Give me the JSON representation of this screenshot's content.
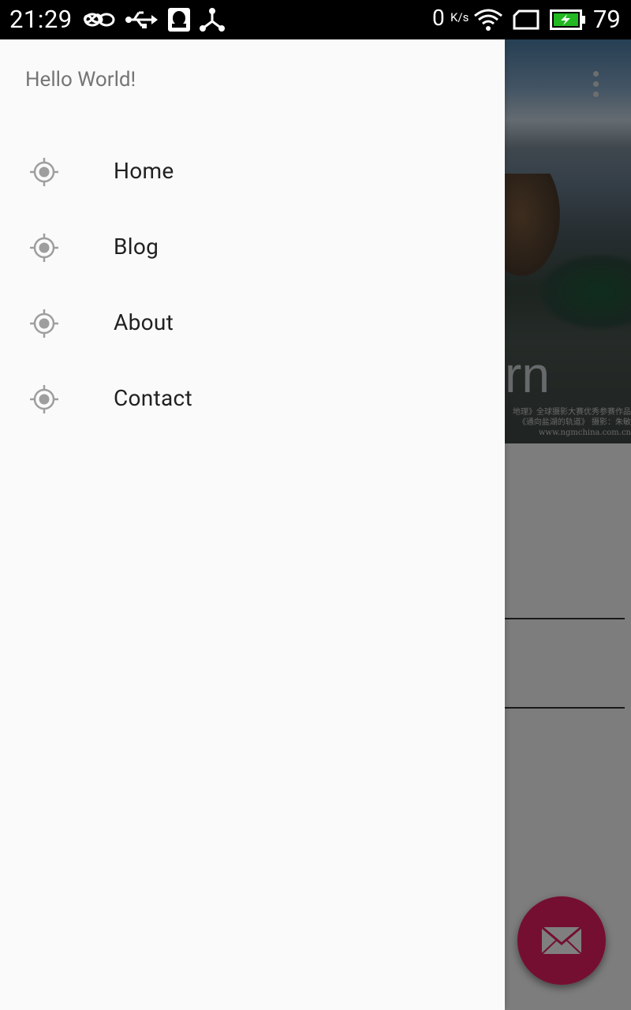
{
  "status_bar": {
    "time": "21:29",
    "net_speed": "0",
    "net_unit": "K/s",
    "battery_level": "79",
    "icons": [
      "infinity-icon",
      "usb-icon",
      "qq-icon",
      "share-icon",
      "wifi-icon",
      "sim-icon",
      "battery-charging-icon"
    ]
  },
  "drawer": {
    "header": "Hello World!",
    "items": [
      {
        "label": "Home",
        "icon": "target-icon"
      },
      {
        "label": "Blog",
        "icon": "target-icon"
      },
      {
        "label": "About",
        "icon": "target-icon"
      },
      {
        "label": "Contact",
        "icon": "target-icon"
      }
    ]
  },
  "background": {
    "image_caption_big": "rn",
    "image_caption_line1": "地理》全球摄影大赛优秀参赛作品",
    "image_caption_line2": "《通向盐湖的轨道》 摄影：朱敏",
    "image_caption_line3": "www.ngmchina.com.cn",
    "overflow_icon": "more-vert-icon"
  },
  "fab": {
    "icon": "mail-icon"
  },
  "colors": {
    "accent": "#e91e63",
    "drawer_bg": "#fafafa",
    "icon_gray": "#9e9e9e",
    "text": "#212121"
  }
}
